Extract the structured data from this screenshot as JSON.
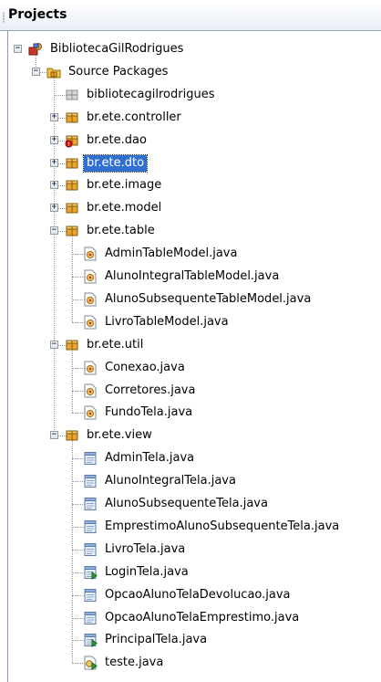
{
  "panel": {
    "title": "Projects"
  },
  "tree": [
    {
      "label": "BibliotecaGilRodrigues",
      "icon": "project-icon",
      "depth": 0,
      "expander": "minus"
    },
    {
      "label": "Source Packages",
      "icon": "source-packages-icon",
      "depth": 1,
      "expander": "minus"
    },
    {
      "label": "bibliotecagilrodrigues",
      "icon": "empty-package-icon",
      "depth": 2,
      "expander": "none"
    },
    {
      "label": "br.ete.controller",
      "icon": "package-icon",
      "depth": 2,
      "expander": "plus"
    },
    {
      "label": "br.ete.dao",
      "icon": "package-error-icon",
      "depth": 2,
      "expander": "plus"
    },
    {
      "label": "br.ete.dto",
      "icon": "package-icon",
      "depth": 2,
      "expander": "plus",
      "selected": true
    },
    {
      "label": "br.ete.image",
      "icon": "package-icon",
      "depth": 2,
      "expander": "plus"
    },
    {
      "label": "br.ete.model",
      "icon": "package-icon",
      "depth": 2,
      "expander": "plus"
    },
    {
      "label": "br.ete.table",
      "icon": "package-icon",
      "depth": 2,
      "expander": "minus"
    },
    {
      "label": "AdminTableModel.java",
      "icon": "java-class-icon",
      "depth": 3,
      "expander": "none"
    },
    {
      "label": "AlunoIntegralTableModel.java",
      "icon": "java-class-icon",
      "depth": 3,
      "expander": "none"
    },
    {
      "label": "AlunoSubsequenteTableModel.java",
      "icon": "java-class-icon",
      "depth": 3,
      "expander": "none"
    },
    {
      "label": "LivroTableModel.java",
      "icon": "java-class-icon",
      "depth": 3,
      "expander": "none"
    },
    {
      "label": "br.ete.util",
      "icon": "package-icon",
      "depth": 2,
      "expander": "minus"
    },
    {
      "label": "Conexao.java",
      "icon": "java-class-icon",
      "depth": 3,
      "expander": "none"
    },
    {
      "label": "Corretores.java",
      "icon": "java-class-icon",
      "depth": 3,
      "expander": "none"
    },
    {
      "label": "FundoTela.java",
      "icon": "java-class-icon",
      "depth": 3,
      "expander": "none"
    },
    {
      "label": "br.ete.view",
      "icon": "package-icon",
      "depth": 2,
      "expander": "minus"
    },
    {
      "label": "AdminTela.java",
      "icon": "java-form-icon",
      "depth": 3,
      "expander": "none"
    },
    {
      "label": "AlunoIntegralTela.java",
      "icon": "java-form-icon",
      "depth": 3,
      "expander": "none"
    },
    {
      "label": "AlunoSubsequenteTela.java",
      "icon": "java-form-icon",
      "depth": 3,
      "expander": "none"
    },
    {
      "label": "EmprestimoAlunoSubsequenteTela.java",
      "icon": "java-form-icon",
      "depth": 3,
      "expander": "none"
    },
    {
      "label": "LivroTela.java",
      "icon": "java-form-icon",
      "depth": 3,
      "expander": "none"
    },
    {
      "label": "LoginTela.java",
      "icon": "java-form-main-icon",
      "depth": 3,
      "expander": "none"
    },
    {
      "label": "OpcaoAlunoTelaDevolucao.java",
      "icon": "java-form-icon",
      "depth": 3,
      "expander": "none"
    },
    {
      "label": "OpcaoAlunoTelaEmprestimo.java",
      "icon": "java-form-icon",
      "depth": 3,
      "expander": "none"
    },
    {
      "label": "PrincipalTela.java",
      "icon": "java-form-main-icon",
      "depth": 3,
      "expander": "none"
    },
    {
      "label": "teste.java",
      "icon": "java-main-class-icon",
      "depth": 3,
      "expander": "none"
    }
  ],
  "colors": {
    "selection": "#2f6fd0",
    "package": "#e8a630",
    "header_border": "#9aa7ba"
  }
}
